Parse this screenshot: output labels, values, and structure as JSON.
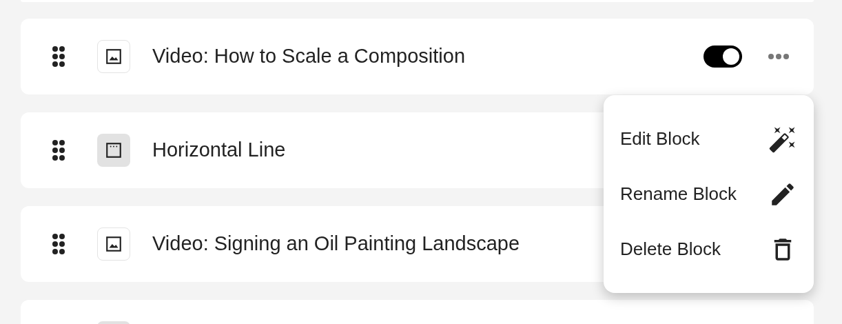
{
  "blocks": [
    {
      "kind": "image",
      "title": "Video: How to Scale a Composition",
      "toggle": {
        "on": true
      },
      "more": true
    },
    {
      "kind": "line",
      "title": "Horizontal Line"
    },
    {
      "kind": "image",
      "title": "Video: Signing an Oil Painting Landscape"
    },
    {
      "kind": "line"
    }
  ],
  "menu": {
    "items": [
      {
        "kind": "edit",
        "label": "Edit Block"
      },
      {
        "kind": "rename",
        "label": "Rename Block"
      },
      {
        "kind": "delete",
        "label": "Delete Block"
      }
    ]
  }
}
